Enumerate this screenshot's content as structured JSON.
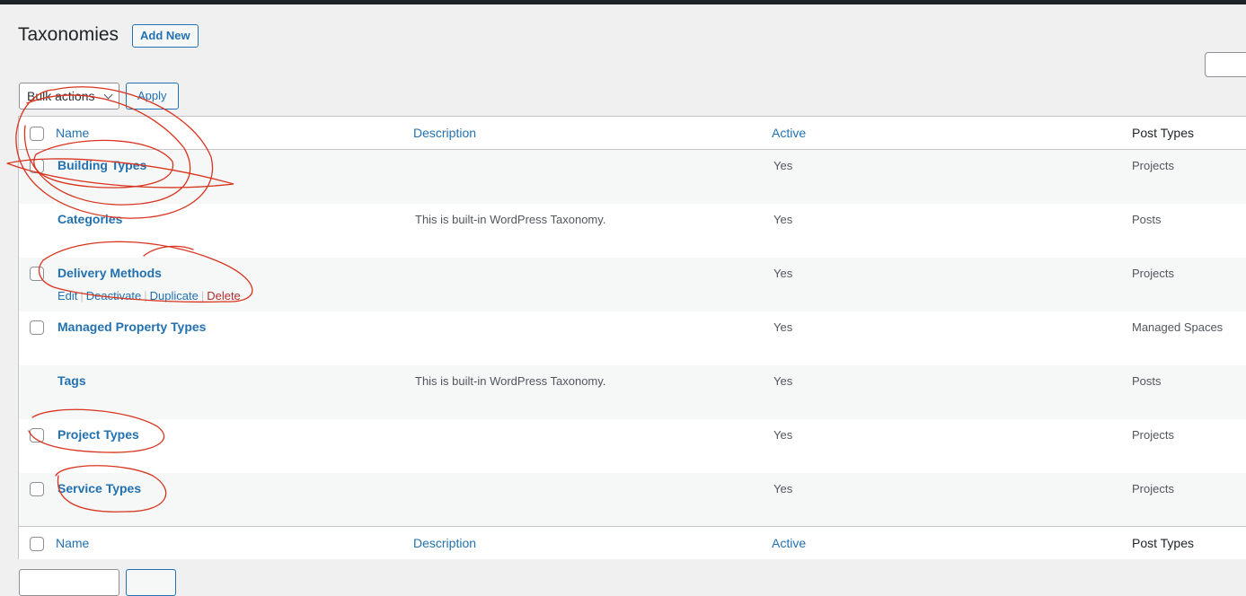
{
  "header": {
    "title": "Taxonomies",
    "add_new_label": "Add New"
  },
  "toolbar": {
    "bulk_actions_label": "Bulk actions",
    "apply_label": "Apply"
  },
  "table": {
    "columns": {
      "name": "Name",
      "description": "Description",
      "active": "Active",
      "post_types": "Post Types"
    },
    "rows": [
      {
        "name": "Building Types",
        "description": "",
        "active": "Yes",
        "post_types": "Projects"
      },
      {
        "name": "Categories",
        "description": "This is built-in WordPress Taxonomy.",
        "active": "Yes",
        "post_types": "Posts"
      },
      {
        "name": "Delivery Methods",
        "description": "",
        "active": "Yes",
        "post_types": "Projects"
      },
      {
        "name": "Managed Property Types",
        "description": "",
        "active": "Yes",
        "post_types": "Managed Spaces"
      },
      {
        "name": "Tags",
        "description": "This is built-in WordPress Taxonomy.",
        "active": "Yes",
        "post_types": "Posts"
      },
      {
        "name": "Project Types",
        "description": "",
        "active": "Yes",
        "post_types": "Projects"
      },
      {
        "name": "Service Types",
        "description": "",
        "active": "Yes",
        "post_types": "Projects"
      }
    ],
    "row_actions": {
      "edit": "Edit",
      "deactivate": "Deactivate",
      "duplicate": "Duplicate",
      "delete": "Delete"
    }
  },
  "colors": {
    "link": "#2271b1",
    "delete": "#b32d2e",
    "annotation": "#d8341e"
  }
}
